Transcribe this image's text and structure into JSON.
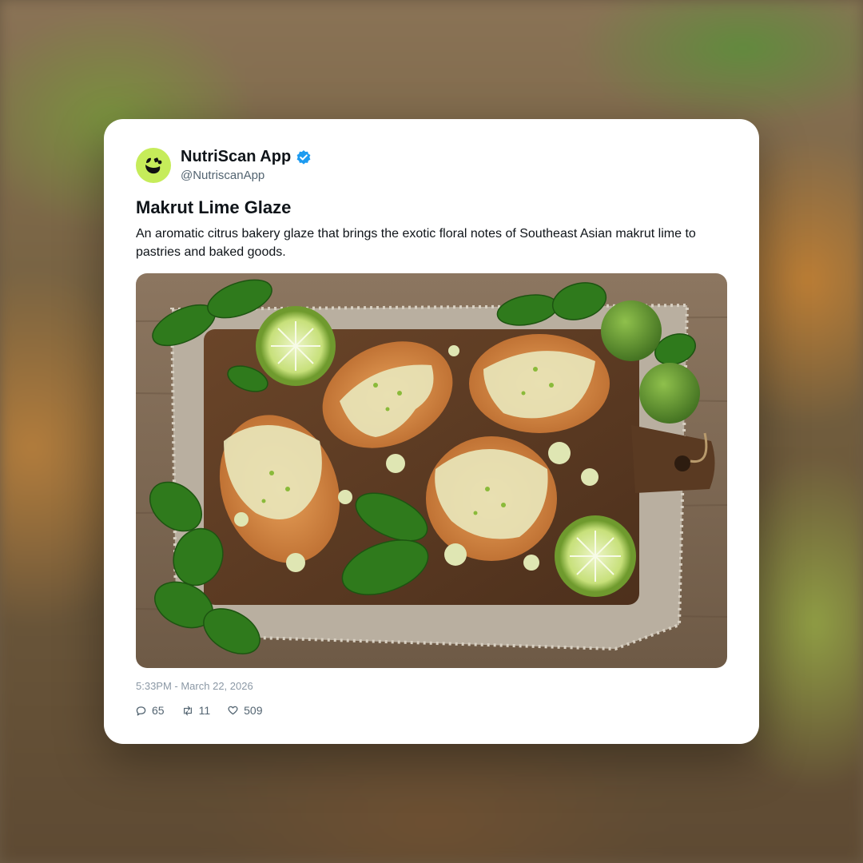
{
  "post": {
    "display_name": "NutriScan App",
    "handle": "@NutriscanApp",
    "verified": true,
    "title": "Makrut Lime Glaze",
    "description": "An aromatic citrus bakery glaze that brings the exotic floral notes of Southeast Asian makrut lime to pastries and baked goods.",
    "timestamp": "5:33PM - March 22, 2026",
    "stats": {
      "replies": "65",
      "reposts": "11",
      "likes": "509"
    }
  },
  "icons": {
    "avatar": "leaf-logo-icon",
    "verified": "verified-badge-icon",
    "reply": "reply-icon",
    "repost": "repost-icon",
    "like": "heart-icon"
  },
  "colors": {
    "avatar_bg": "#c6ec5a",
    "verified": "#1d9bf0",
    "card_bg": "#ffffff"
  }
}
